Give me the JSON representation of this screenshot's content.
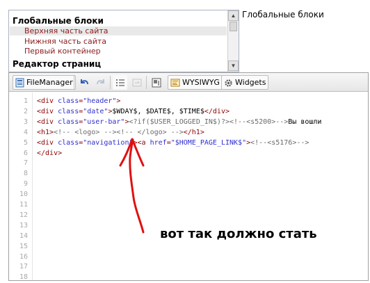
{
  "blocks_list": {
    "groups": [
      {
        "title": "Глобальные блоки",
        "items": [
          {
            "label": "Верхняя часть сайта",
            "selected": true
          },
          {
            "label": "Нижняя часть сайта",
            "selected": false
          },
          {
            "label": "Первый контейнер",
            "selected": false
          }
        ]
      },
      {
        "title": "Редактор страниц"
      }
    ]
  },
  "right_panel": {
    "title": "Глобальные блоки"
  },
  "toolbar": {
    "filemanager_label": "FileManager",
    "wysiwyg_label": "WYSIWYG",
    "widgets_label": "Widgets"
  },
  "code": {
    "line_numbers": [
      "1",
      "2",
      "3",
      "4",
      "5",
      "6",
      "7",
      "8",
      "9",
      "10",
      "11",
      "12",
      "13",
      "14",
      "15",
      "16",
      "17",
      "18"
    ],
    "lines": [
      [
        [
          "t-tag",
          "<div "
        ],
        [
          "t-attr",
          "class"
        ],
        [
          "t-tag",
          "="
        ],
        [
          "t-str",
          "\"header\""
        ],
        [
          "t-tag",
          ">"
        ]
      ],
      [
        [
          "t-tag",
          "<div "
        ],
        [
          "t-attr",
          "class"
        ],
        [
          "t-tag",
          "="
        ],
        [
          "t-str",
          "\"date\""
        ],
        [
          "t-tag",
          ">"
        ],
        [
          "t-txt",
          "$WDAY$, $DATE$, $TIME$"
        ],
        [
          "t-tag",
          "</div>"
        ]
      ],
      [
        [
          "t-tag",
          "<div "
        ],
        [
          "t-attr",
          "class"
        ],
        [
          "t-tag",
          "="
        ],
        [
          "t-str",
          "\"user-bar\""
        ],
        [
          "t-tag",
          ">"
        ],
        [
          "t-cm",
          "<?if($USER_LOGGED_IN$)?><!--<s5200>-->"
        ],
        [
          "t-txt",
          "Вы вошли"
        ]
      ],
      [
        [
          "t-tag",
          "<h1>"
        ],
        [
          "t-cm",
          "<!-- <logo> --><!-- </logo> -->"
        ],
        [
          "t-tag",
          "</h1>"
        ]
      ],
      [
        [
          "t-tag",
          "<div "
        ],
        [
          "t-attr",
          "class"
        ],
        [
          "t-tag",
          "="
        ],
        [
          "t-str",
          "\"navigation\""
        ],
        [
          "t-tag",
          ">"
        ],
        [
          "t-tag",
          "<a "
        ],
        [
          "t-attr",
          "href"
        ],
        [
          "t-tag",
          "="
        ],
        [
          "t-str",
          "\"$HOME_PAGE_LINK$\""
        ],
        [
          "t-tag",
          ">"
        ],
        [
          "t-cm",
          "<!--<s5176>-->"
        ]
      ],
      [
        [
          "t-tag",
          "</div>"
        ]
      ]
    ]
  },
  "annotation": {
    "text": "вот так должно стать",
    "arrow_color": "#e01010"
  }
}
